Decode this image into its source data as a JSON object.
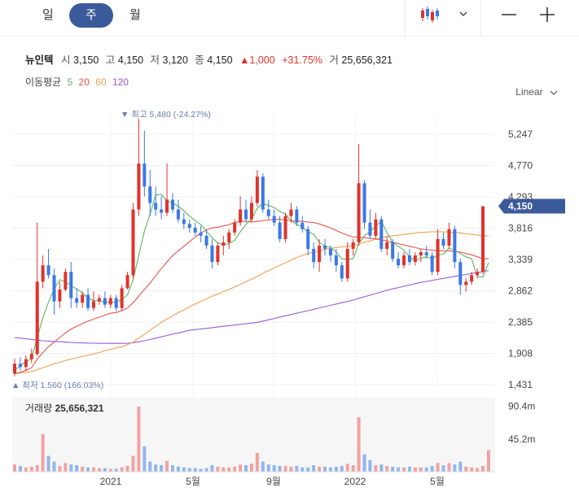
{
  "tabs": [
    {
      "label": "일",
      "active": false
    },
    {
      "label": "주",
      "active": true
    },
    {
      "label": "월",
      "active": false
    }
  ],
  "toolbar": {
    "chart_type_icon": "candlestick-icon",
    "dropdown_icon": "chevron-down-icon",
    "zoom_out_icon": "minus-icon",
    "zoom_in_icon": "plus-icon"
  },
  "quote": {
    "name": "뉴인텍",
    "open_label": "시",
    "open": "3,150",
    "high_label": "고",
    "high": "4,150",
    "low_label": "저",
    "low": "3,120",
    "close_label": "종",
    "close": "4,150",
    "change": "▲1,000",
    "change_pct": "+31.75%",
    "volume_label": "거",
    "volume": "25,656,321"
  },
  "moving_average": {
    "label": "이동평균",
    "periods": [
      {
        "label": "5",
        "color": "#5cb85c"
      },
      {
        "label": "20",
        "color": "#e8554e"
      },
      {
        "label": "60",
        "color": "#f0a050"
      },
      {
        "label": "120",
        "color": "#9b59d6"
      }
    ]
  },
  "scale_label": "Linear",
  "chart_data": {
    "type": "candlestick",
    "y_ticks": [
      "5,247",
      "4,770",
      "4,293",
      "3,816",
      "3,339",
      "2,862",
      "2,385",
      "1,908",
      "1,431"
    ],
    "y_tick_values": [
      5247,
      4770,
      4293,
      3816,
      3339,
      2862,
      2385,
      1908,
      1431
    ],
    "x_ticks": [
      "2021",
      "5월",
      "9월",
      "2022",
      "5월"
    ],
    "current_price": "4,150",
    "max_annotation": "▼ 최고 5,480 (-24.27%)",
    "min_annotation": "▲ 최저 1,560 (166.03%)",
    "volume_label": "거래량",
    "volume_value": "25,656,321",
    "volume_ticks": [
      "90.4m",
      "45.2m"
    ],
    "volume_tick_values": [
      90.4,
      45.2
    ],
    "candles": [
      [
        1600,
        1830,
        1560,
        1750
      ],
      [
        1750,
        1850,
        1650,
        1700
      ],
      [
        1700,
        1880,
        1640,
        1820
      ],
      [
        1820,
        1980,
        1760,
        1900
      ],
      [
        1900,
        3900,
        1870,
        3000
      ],
      [
        3000,
        3400,
        2900,
        3250
      ],
      [
        3250,
        3500,
        3050,
        3100
      ],
      [
        3100,
        3200,
        2500,
        2700
      ],
      [
        2700,
        3000,
        2600,
        2880
      ],
      [
        2880,
        3200,
        2850,
        3150
      ],
      [
        3150,
        3300,
        2600,
        2750
      ],
      [
        2750,
        2900,
        2600,
        2680
      ],
      [
        2680,
        2850,
        2600,
        2800
      ],
      [
        2800,
        2900,
        2550,
        2600
      ],
      [
        2600,
        2850,
        2550,
        2700
      ],
      [
        2700,
        2800,
        2650,
        2750
      ],
      [
        2750,
        2850,
        2600,
        2650
      ],
      [
        2650,
        2800,
        2600,
        2750
      ],
      [
        2750,
        2800,
        2550,
        2600
      ],
      [
        2600,
        2950,
        2550,
        2900
      ],
      [
        2900,
        3150,
        2880,
        3100
      ],
      [
        3100,
        4200,
        3050,
        4100
      ],
      [
        4100,
        5480,
        4000,
        4800
      ],
      [
        4800,
        5300,
        4300,
        4450
      ],
      [
        4450,
        4700,
        4000,
        4200
      ],
      [
        4200,
        4450,
        4000,
        4100
      ],
      [
        4100,
        4300,
        3950,
        4050
      ],
      [
        4050,
        4800,
        4000,
        4250
      ],
      [
        4250,
        4350,
        4050,
        4100
      ],
      [
        4100,
        4250,
        3900,
        3950
      ],
      [
        3950,
        4050,
        3800,
        3880
      ],
      [
        3880,
        3950,
        3750,
        3820
      ],
      [
        3820,
        3900,
        3700,
        3750
      ],
      [
        3750,
        3850,
        3600,
        3700
      ],
      [
        3700,
        3800,
        3500,
        3550
      ],
      [
        3550,
        3650,
        3200,
        3300
      ],
      [
        3300,
        3600,
        3250,
        3550
      ],
      [
        3550,
        3700,
        3400,
        3600
      ],
      [
        3600,
        3800,
        3500,
        3750
      ],
      [
        3750,
        3950,
        3700,
        3900
      ],
      [
        3900,
        4300,
        3850,
        4100
      ],
      [
        4100,
        4250,
        3900,
        3950
      ],
      [
        3950,
        4300,
        3900,
        4200
      ],
      [
        4200,
        4700,
        4150,
        4600
      ],
      [
        4600,
        4650,
        4050,
        4100
      ],
      [
        4100,
        4250,
        3950,
        4000
      ],
      [
        4000,
        4100,
        3850,
        3900
      ],
      [
        3900,
        4000,
        3600,
        3650
      ],
      [
        3650,
        4050,
        3600,
        4000
      ],
      [
        4000,
        4200,
        3900,
        4100
      ],
      [
        4100,
        4150,
        3850,
        3900
      ],
      [
        3900,
        4000,
        3750,
        3800
      ],
      [
        3800,
        3850,
        3400,
        3500
      ],
      [
        3500,
        3600,
        3200,
        3300
      ],
      [
        3300,
        3650,
        3150,
        3550
      ],
      [
        3550,
        3650,
        3400,
        3500
      ],
      [
        3500,
        3550,
        3300,
        3400
      ],
      [
        3400,
        3500,
        3150,
        3250
      ],
      [
        3250,
        3300,
        3000,
        3050
      ],
      [
        3050,
        3600,
        3000,
        3500
      ],
      [
        3500,
        3650,
        3400,
        3600
      ],
      [
        3600,
        5100,
        3550,
        4500
      ],
      [
        4500,
        4550,
        3800,
        3900
      ],
      [
        3900,
        4100,
        3650,
        3700
      ],
      [
        3700,
        4050,
        3650,
        3950
      ],
      [
        3950,
        4000,
        3450,
        3500
      ],
      [
        3500,
        3700,
        3400,
        3600
      ],
      [
        3600,
        3650,
        3300,
        3350
      ],
      [
        3350,
        3450,
        3200,
        3250
      ],
      [
        3250,
        3450,
        3200,
        3400
      ],
      [
        3400,
        3500,
        3250,
        3300
      ],
      [
        3300,
        3450,
        3250,
        3400
      ],
      [
        3400,
        3500,
        3300,
        3450
      ],
      [
        3450,
        3550,
        3350,
        3400
      ],
      [
        3400,
        3450,
        3100,
        3150
      ],
      [
        3150,
        3800,
        3100,
        3650
      ],
      [
        3650,
        3750,
        3500,
        3550
      ],
      [
        3550,
        3900,
        3500,
        3800
      ],
      [
        3800,
        3850,
        3200,
        3300
      ],
      [
        3300,
        3350,
        2800,
        2950
      ],
      [
        2950,
        3050,
        2850,
        3000
      ],
      [
        3000,
        3150,
        2950,
        3100
      ],
      [
        3100,
        3200,
        3050,
        3150
      ],
      [
        3150,
        4150,
        3120,
        4150
      ]
    ],
    "ma5": [
      1650,
      1720,
      1780,
      1830,
      2150,
      2450,
      2690,
      2890,
      3030,
      3000,
      2940,
      2890,
      2830,
      2750,
      2710,
      2710,
      2690,
      2690,
      2690,
      2730,
      2800,
      3030,
      3400,
      3770,
      4030,
      4320,
      4330,
      4230,
      4200,
      4150,
      4080,
      4000,
      3930,
      3870,
      3770,
      3670,
      3590,
      3560,
      3580,
      3630,
      3760,
      3870,
      3960,
      4120,
      4190,
      4160,
      4130,
      4070,
      4030,
      3930,
      3870,
      3830,
      3760,
      3720,
      3600,
      3540,
      3520,
      3450,
      3350,
      3340,
      3350,
      3580,
      3700,
      3760,
      3850,
      3920,
      3750,
      3600,
      3540,
      3480,
      3380,
      3320,
      3360,
      3380,
      3350,
      3410,
      3420,
      3510,
      3480,
      3430,
      3380,
      3350,
      3080,
      3070,
      3290
    ],
    "ma20": [
      1600,
      1620,
      1650,
      1690,
      1820,
      1920,
      2010,
      2080,
      2150,
      2220,
      2280,
      2320,
      2360,
      2400,
      2430,
      2460,
      2490,
      2520,
      2530,
      2560,
      2600,
      2680,
      2780,
      2880,
      2980,
      3090,
      3200,
      3300,
      3400,
      3470,
      3540,
      3610,
      3680,
      3740,
      3790,
      3820,
      3830,
      3850,
      3870,
      3900,
      3920,
      3920,
      3910,
      3920,
      3930,
      3940,
      3950,
      3950,
      3940,
      3930,
      3920,
      3920,
      3910,
      3900,
      3880,
      3850,
      3820,
      3780,
      3740,
      3710,
      3680,
      3680,
      3670,
      3660,
      3650,
      3640,
      3620,
      3600,
      3580,
      3560,
      3540,
      3520,
      3500,
      3490,
      3480,
      3470,
      3470,
      3470,
      3460,
      3450,
      3430,
      3410,
      3380,
      3350,
      3350
    ],
    "ma60": [
      1600,
      1610,
      1620,
      1630,
      1660,
      1690,
      1720,
      1750,
      1770,
      1800,
      1820,
      1840,
      1860,
      1880,
      1900,
      1920,
      1950,
      1970,
      1990,
      2010,
      2040,
      2080,
      2140,
      2200,
      2260,
      2320,
      2380,
      2430,
      2480,
      2530,
      2570,
      2620,
      2660,
      2700,
      2740,
      2780,
      2810,
      2850,
      2880,
      2920,
      2960,
      3000,
      3040,
      3080,
      3130,
      3170,
      3210,
      3250,
      3290,
      3330,
      3370,
      3400,
      3430,
      3450,
      3470,
      3490,
      3510,
      3520,
      3530,
      3540,
      3550,
      3570,
      3600,
      3620,
      3650,
      3670,
      3690,
      3700,
      3710,
      3720,
      3730,
      3740,
      3750,
      3755,
      3760,
      3760,
      3760,
      3755,
      3750,
      3740,
      3730,
      3720,
      3710,
      3700,
      3700
    ],
    "ma120": [
      2150,
      2140,
      2130,
      2120,
      2110,
      2100,
      2095,
      2090,
      2085,
      2080,
      2075,
      2070,
      2068,
      2065,
      2063,
      2062,
      2061,
      2060,
      2060,
      2060,
      2062,
      2070,
      2085,
      2100,
      2120,
      2140,
      2160,
      2180,
      2200,
      2220,
      2240,
      2260,
      2270,
      2280,
      2290,
      2300,
      2310,
      2320,
      2330,
      2340,
      2350,
      2360,
      2370,
      2380,
      2400,
      2420,
      2440,
      2460,
      2480,
      2500,
      2520,
      2540,
      2560,
      2580,
      2600,
      2620,
      2640,
      2660,
      2680,
      2700,
      2720,
      2745,
      2770,
      2795,
      2820,
      2845,
      2870,
      2890,
      2910,
      2930,
      2950,
      2970,
      2990,
      3005,
      3020,
      3035,
      3050,
      3065,
      3080,
      3095,
      3110,
      3125,
      3140,
      3155,
      3170
    ],
    "volumes": [
      10,
      8,
      6,
      7,
      9,
      52,
      22,
      14,
      8,
      12,
      10,
      9,
      7,
      6,
      6,
      5,
      5,
      4,
      4,
      6,
      8,
      22,
      90,
      35,
      14,
      10,
      9,
      15,
      9,
      7,
      6,
      5,
      5,
      4,
      5,
      9,
      7,
      6,
      6,
      7,
      10,
      9,
      11,
      26,
      14,
      10,
      9,
      8,
      8,
      7,
      8,
      6,
      6,
      9,
      7,
      7,
      6,
      7,
      8,
      11,
      9,
      75,
      24,
      16,
      9,
      10,
      8,
      7,
      6,
      6,
      7,
      6,
      6,
      6,
      8,
      12,
      9,
      12,
      10,
      14,
      7,
      6,
      5,
      8,
      30
    ],
    "volume_up_flags": [
      1,
      0,
      1,
      1,
      1,
      1,
      0,
      0,
      1,
      1,
      0,
      0,
      1,
      0,
      1,
      1,
      0,
      1,
      0,
      1,
      1,
      1,
      1,
      0,
      0,
      0,
      0,
      1,
      0,
      0,
      0,
      0,
      0,
      0,
      0,
      0,
      1,
      1,
      1,
      1,
      1,
      0,
      1,
      1,
      0,
      0,
      0,
      0,
      1,
      1,
      0,
      0,
      0,
      0,
      1,
      0,
      0,
      0,
      0,
      1,
      1,
      1,
      0,
      0,
      1,
      0,
      1,
      0,
      0,
      1,
      0,
      1,
      1,
      0,
      0,
      1,
      0,
      1,
      0,
      0,
      1,
      1,
      1,
      1,
      1
    ]
  }
}
